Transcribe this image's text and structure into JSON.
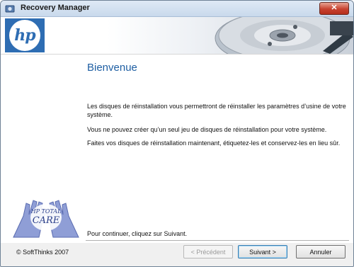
{
  "window": {
    "title": "Recovery Manager",
    "close_glyph": "✕"
  },
  "banner": {
    "logo_text": "hp",
    "logo_color": "#2e6db3"
  },
  "content": {
    "heading": "Bienvenue",
    "paragraphs": [
      "Les disques de réinstallation vous permettront de réinstaller les paramètres d’usine de votre système.",
      "Vous ne pouvez créer qu’un seul jeu de disques de réinstallation pour votre système.",
      "Faites vos disques de réinstallation maintenant, étiquetez-les et conservez-les en lieu sûr."
    ],
    "continue_text": "Pour continuer, cliquez sur Suivant."
  },
  "hands_logo": {
    "text": "HP TOTAL CARE"
  },
  "footer": {
    "copyright": "© SoftThinks 2007",
    "previous_label": "< Précédent",
    "next_label": "Suivant >",
    "cancel_label": "Annuler"
  }
}
